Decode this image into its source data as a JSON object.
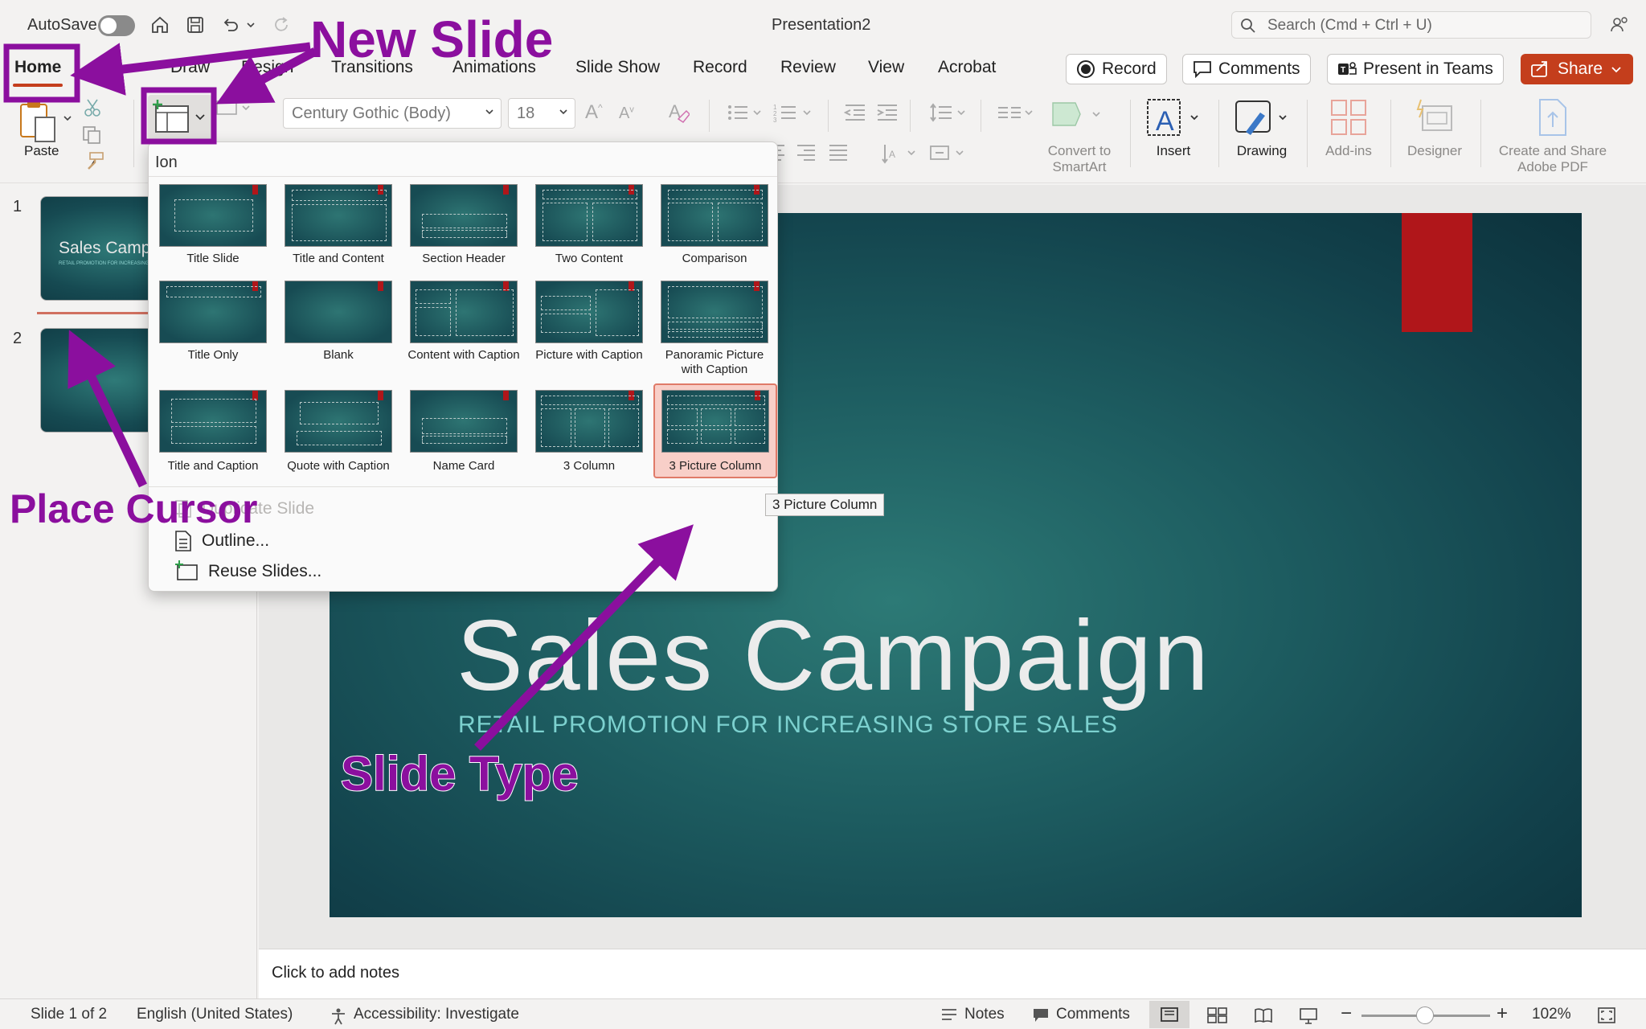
{
  "titlebar": {
    "autosave_label": "AutoSave",
    "doc_title": "Presentation2",
    "search_placeholder": "Search (Cmd + Ctrl + U)"
  },
  "tabs": [
    "Home",
    "Draw",
    "Design",
    "Transitions",
    "Animations",
    "Slide Show",
    "Record",
    "Review",
    "View",
    "Acrobat"
  ],
  "actions": {
    "record": "Record",
    "comments": "Comments",
    "present": "Present in Teams",
    "share": "Share"
  },
  "ribbon": {
    "paste": "Paste",
    "font_name": "Century Gothic (Body)",
    "font_size": "18",
    "convert_smartart": "Convert to SmartArt",
    "insert": "Insert",
    "drawing": "Drawing",
    "addins": "Add-ins",
    "designer": "Designer",
    "create_share_pdf": "Create and Share Adobe PDF"
  },
  "thumbnails": [
    {
      "num": "1",
      "title": "Sales Campaign",
      "subtitle": "RETAIL PROMOTION FOR INCREASING STORE SALES"
    },
    {
      "num": "2"
    }
  ],
  "gallery": {
    "header": "Ion",
    "layouts": [
      "Title Slide",
      "Title and Content",
      "Section Header",
      "Two Content",
      "Comparison",
      "Title Only",
      "Blank",
      "Content with Caption",
      "Picture with Caption",
      "Panoramic Picture with Caption",
      "Title and Caption",
      "Quote with Caption",
      "Name Card",
      "3 Column",
      "3 Picture Column"
    ],
    "selected": "3 Picture Column",
    "menu": [
      "Duplicate Slide",
      "Outline...",
      "Reuse Slides..."
    ],
    "tooltip": "3 Picture Column"
  },
  "slide": {
    "title": "Sales Campaign",
    "subtitle": "RETAIL PROMOTION FOR INCREASING STORE SALES"
  },
  "notes_placeholder": "Click to add notes",
  "statusbar": {
    "slide_info": "Slide 1 of 2",
    "language": "English (United States)",
    "accessibility": "Accessibility: Investigate",
    "notes": "Notes",
    "comments": "Comments",
    "zoom": "102%",
    "zoom_level": 1.02
  },
  "annotations": {
    "new_slide": "New Slide",
    "place_cursor": "Place Cursor",
    "slide_type": "Slide Type",
    "color": "#8b0f9e"
  },
  "colors": {
    "accent": "#c43e1c",
    "slide_red": "#b0161a",
    "slide_teal": "#1d5c60"
  }
}
